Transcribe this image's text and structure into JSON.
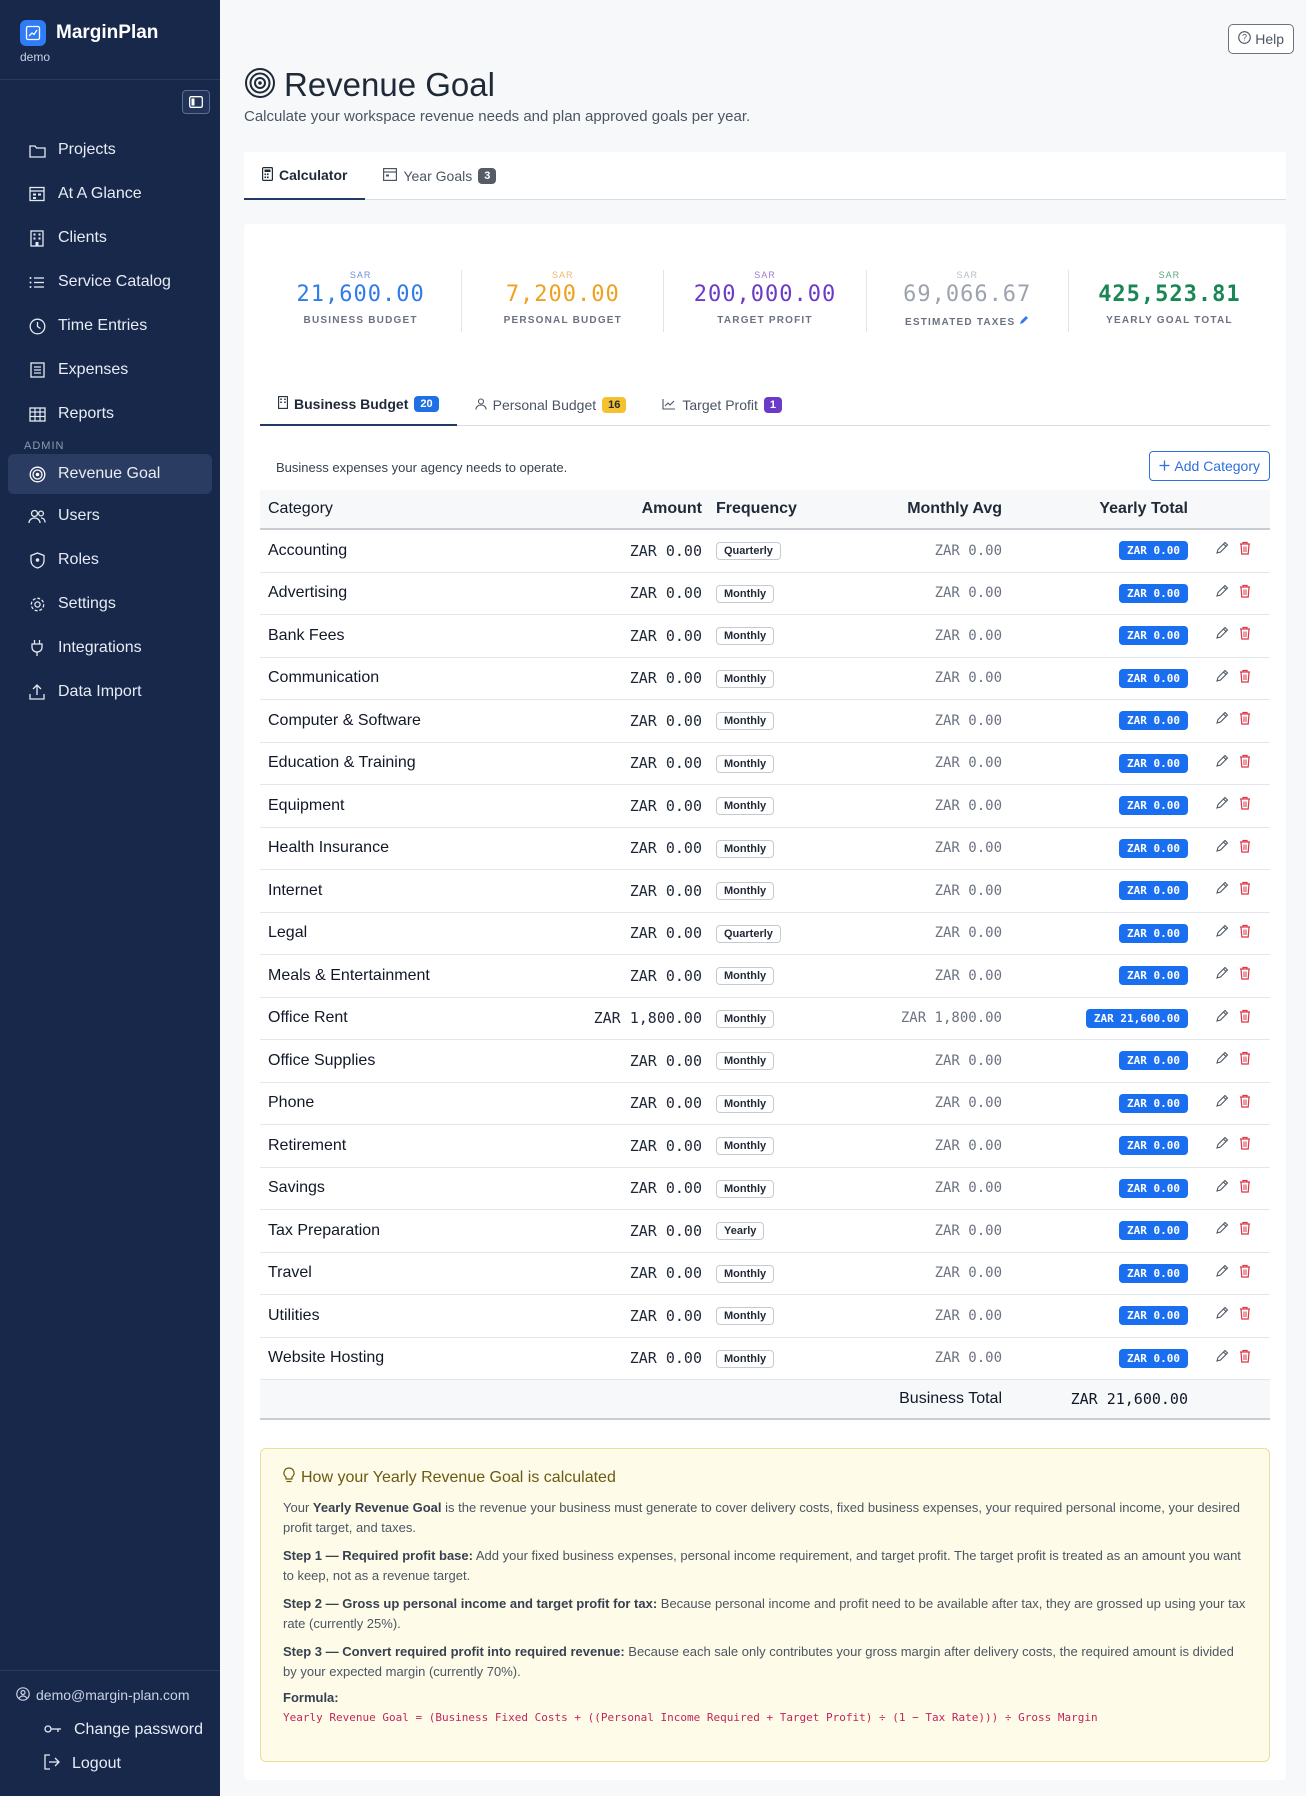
{
  "app": {
    "name": "MarginPlan",
    "workspace": "demo"
  },
  "sidebar": {
    "items": [
      {
        "label": "Projects",
        "icon": "folder-icon"
      },
      {
        "label": "At A Glance",
        "icon": "calendar-icon"
      },
      {
        "label": "Clients",
        "icon": "building-icon"
      },
      {
        "label": "Service Catalog",
        "icon": "list-icon"
      },
      {
        "label": "Time Entries",
        "icon": "clock-icon"
      },
      {
        "label": "Expenses",
        "icon": "receipt-icon"
      },
      {
        "label": "Reports",
        "icon": "table-icon"
      }
    ],
    "admin_label": "ADMIN",
    "admin_items": [
      {
        "label": "Revenue Goal",
        "icon": "target-icon",
        "active": true
      },
      {
        "label": "Users",
        "icon": "users-icon"
      },
      {
        "label": "Roles",
        "icon": "shield-icon"
      },
      {
        "label": "Settings",
        "icon": "gear-icon"
      },
      {
        "label": "Integrations",
        "icon": "plug-icon"
      },
      {
        "label": "Data Import",
        "icon": "upload-icon"
      }
    ],
    "user_email": "demo@margin-plan.com",
    "change_password": "Change password",
    "logout": "Logout"
  },
  "header": {
    "help": "Help",
    "title": "Revenue Goal",
    "subtitle": "Calculate your workspace revenue needs and plan approved goals per year."
  },
  "top_tabs": [
    {
      "label": "Calculator",
      "active": true
    },
    {
      "label": "Year Goals",
      "badge": "3"
    }
  ],
  "summary": [
    {
      "currency": "SAR",
      "value": "21,600.00",
      "label": "BUSINESS BUDGET",
      "color": "#2f7ce8"
    },
    {
      "currency": "SAR",
      "value": "7,200.00",
      "label": "PERSONAL BUDGET",
      "color": "#f0a020"
    },
    {
      "currency": "SAR",
      "value": "200,000.00",
      "label": "TARGET PROFIT",
      "color": "#6b3bc8"
    },
    {
      "currency": "SAR",
      "value": "69,066.67",
      "label": "ESTIMATED TAXES",
      "color": "#9ca3af"
    },
    {
      "currency": "SAR",
      "value": "425,523.81",
      "label": "YEARLY GOAL TOTAL",
      "color": "#198754"
    }
  ],
  "sub_tabs": [
    {
      "label": "Business Budget",
      "badge": "20"
    },
    {
      "label": "Personal Budget",
      "badge": "16"
    },
    {
      "label": "Target Profit",
      "badge": "1"
    }
  ],
  "budget": {
    "description": "Business expenses your agency needs to operate.",
    "add_label": "Add Category",
    "columns": {
      "category": "Category",
      "amount": "Amount",
      "frequency": "Frequency",
      "monthly": "Monthly Avg",
      "yearly": "Yearly Total"
    },
    "rows": [
      {
        "category": "Accounting",
        "amount": "ZAR 0.00",
        "frequency": "Quarterly",
        "monthly": "ZAR 0.00",
        "yearly": "ZAR 0.00"
      },
      {
        "category": "Advertising",
        "amount": "ZAR 0.00",
        "frequency": "Monthly",
        "monthly": "ZAR 0.00",
        "yearly": "ZAR 0.00"
      },
      {
        "category": "Bank Fees",
        "amount": "ZAR 0.00",
        "frequency": "Monthly",
        "monthly": "ZAR 0.00",
        "yearly": "ZAR 0.00"
      },
      {
        "category": "Communication",
        "amount": "ZAR 0.00",
        "frequency": "Monthly",
        "monthly": "ZAR 0.00",
        "yearly": "ZAR 0.00"
      },
      {
        "category": "Computer & Software",
        "amount": "ZAR 0.00",
        "frequency": "Monthly",
        "monthly": "ZAR 0.00",
        "yearly": "ZAR 0.00"
      },
      {
        "category": "Education & Training",
        "amount": "ZAR 0.00",
        "frequency": "Monthly",
        "monthly": "ZAR 0.00",
        "yearly": "ZAR 0.00"
      },
      {
        "category": "Equipment",
        "amount": "ZAR 0.00",
        "frequency": "Monthly",
        "monthly": "ZAR 0.00",
        "yearly": "ZAR 0.00"
      },
      {
        "category": "Health Insurance",
        "amount": "ZAR 0.00",
        "frequency": "Monthly",
        "monthly": "ZAR 0.00",
        "yearly": "ZAR 0.00"
      },
      {
        "category": "Internet",
        "amount": "ZAR 0.00",
        "frequency": "Monthly",
        "monthly": "ZAR 0.00",
        "yearly": "ZAR 0.00"
      },
      {
        "category": "Legal",
        "amount": "ZAR 0.00",
        "frequency": "Quarterly",
        "monthly": "ZAR 0.00",
        "yearly": "ZAR 0.00"
      },
      {
        "category": "Meals & Entertainment",
        "amount": "ZAR 0.00",
        "frequency": "Monthly",
        "monthly": "ZAR 0.00",
        "yearly": "ZAR 0.00"
      },
      {
        "category": "Office Rent",
        "amount": "ZAR 1,800.00",
        "frequency": "Monthly",
        "monthly": "ZAR 1,800.00",
        "yearly": "ZAR 21,600.00"
      },
      {
        "category": "Office Supplies",
        "amount": "ZAR 0.00",
        "frequency": "Monthly",
        "monthly": "ZAR 0.00",
        "yearly": "ZAR 0.00"
      },
      {
        "category": "Phone",
        "amount": "ZAR 0.00",
        "frequency": "Monthly",
        "monthly": "ZAR 0.00",
        "yearly": "ZAR 0.00"
      },
      {
        "category": "Retirement",
        "amount": "ZAR 0.00",
        "frequency": "Monthly",
        "monthly": "ZAR 0.00",
        "yearly": "ZAR 0.00"
      },
      {
        "category": "Savings",
        "amount": "ZAR 0.00",
        "frequency": "Monthly",
        "monthly": "ZAR 0.00",
        "yearly": "ZAR 0.00"
      },
      {
        "category": "Tax Preparation",
        "amount": "ZAR 0.00",
        "frequency": "Yearly",
        "monthly": "ZAR 0.00",
        "yearly": "ZAR 0.00"
      },
      {
        "category": "Travel",
        "amount": "ZAR 0.00",
        "frequency": "Monthly",
        "monthly": "ZAR 0.00",
        "yearly": "ZAR 0.00"
      },
      {
        "category": "Utilities",
        "amount": "ZAR 0.00",
        "frequency": "Monthly",
        "monthly": "ZAR 0.00",
        "yearly": "ZAR 0.00"
      },
      {
        "category": "Website Hosting",
        "amount": "ZAR 0.00",
        "frequency": "Monthly",
        "monthly": "ZAR 0.00",
        "yearly": "ZAR 0.00"
      }
    ],
    "total_label": "Business Total",
    "total_value": "ZAR 21,600.00"
  },
  "info": {
    "title": "How your Yearly Revenue Goal is calculated",
    "intro_pre": "Your ",
    "intro_bold": "Yearly Revenue Goal",
    "intro_post": " is the revenue your business must generate to cover delivery costs, fixed business expenses, your required personal income, your desired profit target, and taxes.",
    "step1_bold": "Step 1 — Required profit base:",
    "step1": " Add your fixed business expenses, personal income requirement, and target profit. The target profit is treated as an amount you want to keep, not as a revenue target.",
    "step2_bold": "Step 2 — Gross up personal income and target profit for tax:",
    "step2": " Because personal income and profit need to be available after tax, they are grossed up using your tax rate (currently 25%).",
    "step3_bold": "Step 3 — Convert required profit into required revenue:",
    "step3": " Because each sale only contributes your gross margin after delivery costs, the required amount is divided by your expected margin (currently 70%).",
    "formula_label": "Formula:",
    "formula": "Yearly Revenue Goal = (Business Fixed Costs + ((Personal Income Required + Target Profit) ÷ (1 − Tax Rate))) ÷ Gross Margin"
  }
}
